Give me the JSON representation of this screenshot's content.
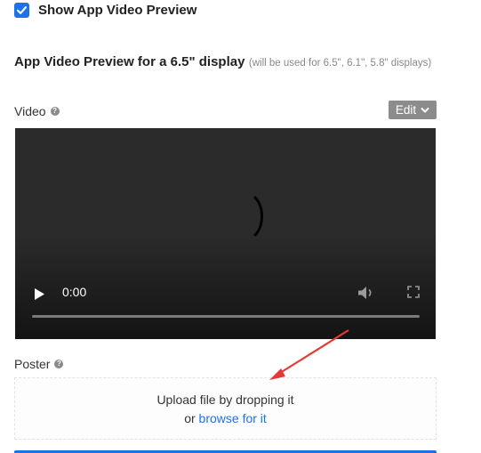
{
  "preview_toggle": {
    "label": "Show App Video Preview",
    "checked": true
  },
  "section": {
    "title": "App Video Preview for a 6.5\" display",
    "note": "(will be used for 6.5\", 6.1\", 5.8\" displays)"
  },
  "video_field": {
    "label": "Video",
    "edit_label": "Edit",
    "player": {
      "time": "0:00",
      "progress": 0
    }
  },
  "poster_field": {
    "label": "Poster",
    "upload_text": "Upload file by dropping it",
    "or_text": "or ",
    "browse_label": "browse for it"
  },
  "colors": {
    "accent": "#1a73e8",
    "annotation": "#e53935",
    "video_bg": "#2b2b2b"
  },
  "icons": [
    "checkmark-icon",
    "help-icon",
    "chevron-down-icon",
    "loading-spinner-icon",
    "play-icon",
    "volume-icon",
    "fullscreen-icon"
  ]
}
